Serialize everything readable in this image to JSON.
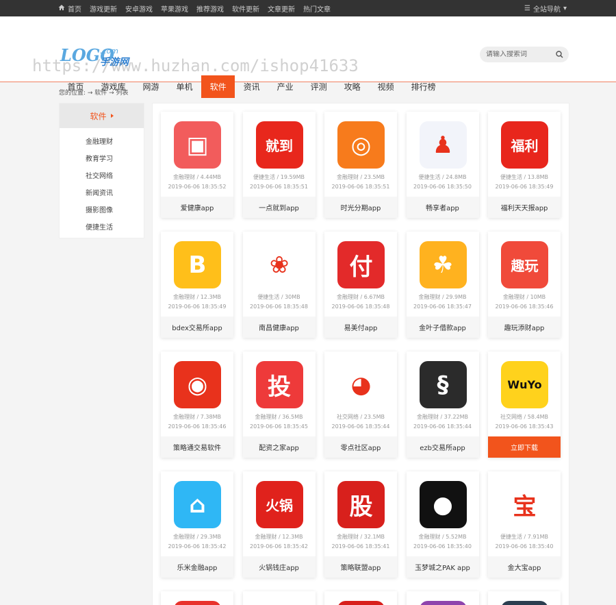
{
  "topbar": {
    "links": [
      "首页",
      "游戏更新",
      "安卓游戏",
      "苹果游戏",
      "推荐游戏",
      "软件更新",
      "文章更新",
      "热门文章"
    ],
    "site_nav": "全站导航"
  },
  "logo": {
    "main": "LOGO",
    "com": ".com",
    "sub": "手游网"
  },
  "watermark": "https://www.huzhan.com/ishop41633",
  "search": {
    "placeholder": "请输入搜索词"
  },
  "nav": {
    "items": [
      "首页",
      "游戏库",
      "网游",
      "单机",
      "软件",
      "资讯",
      "产业",
      "评测",
      "攻略",
      "视频",
      "排行榜"
    ],
    "active_index": 4
  },
  "breadcrumb": "您的位置: → 软件 → 列表",
  "sidebar": {
    "title": "软件",
    "items": [
      "金融理财",
      "教育学习",
      "社交网络",
      "新闻资讯",
      "摄影图像",
      "便捷生活"
    ]
  },
  "download_label": "立即下载",
  "apps": [
    {
      "name": "爱健康app",
      "category": "金融理财",
      "size": "4.44MB",
      "date": "2019-06-06 18:35:52",
      "icon": "health-app-icon",
      "color": "#f25c5c",
      "glyph": "▣"
    },
    {
      "name": "一点就到app",
      "category": "便捷生活",
      "size": "19.59MB",
      "date": "2019-06-06 18:35:51",
      "icon": "smile-app-icon",
      "color": "#e8271c",
      "glyph": "就到"
    },
    {
      "name": "时光分期app",
      "category": "金融理财",
      "size": "23.5MB",
      "date": "2019-06-06 18:35:51",
      "icon": "coin-app-icon",
      "color": "#f77b1c",
      "glyph": "◎"
    },
    {
      "name": "畅享者app",
      "category": "便捷生活",
      "size": "24.8MB",
      "date": "2019-06-06 18:35:50",
      "icon": "person-app-icon",
      "color": "#f2f4fa",
      "glyph": "♟"
    },
    {
      "name": "福利天天报app",
      "category": "便捷生活",
      "size": "13.8MB",
      "date": "2019-06-06 18:35:49",
      "icon": "gift-app-icon",
      "color": "#e8261c",
      "glyph": "福利"
    },
    {
      "name": "bdex交易所app",
      "category": "金融理财",
      "size": "12.3MB",
      "date": "2019-06-06 18:35:49",
      "icon": "b-app-icon",
      "color": "#ffbf1a",
      "glyph": "B"
    },
    {
      "name": "南昌健康app",
      "category": "便捷生活",
      "size": "30MB",
      "date": "2019-06-06 18:35:48",
      "icon": "emblem-app-icon",
      "color": "#ffffff",
      "glyph": "❀"
    },
    {
      "name": "易美付app",
      "category": "金融理财",
      "size": "6.67MB",
      "date": "2019-06-06 18:35:48",
      "icon": "pay-app-icon",
      "color": "#e32a2a",
      "glyph": "付"
    },
    {
      "name": "金叶子借款app",
      "category": "金融理财",
      "size": "29.9MB",
      "date": "2019-06-06 18:35:47",
      "icon": "leaf-app-icon",
      "color": "#ffb21f",
      "glyph": "☘"
    },
    {
      "name": "趣玩添财app",
      "category": "金融理财",
      "size": "10MB",
      "date": "2019-06-06 18:35:46",
      "icon": "fun-app-icon",
      "color": "#f04a3a",
      "glyph": "趣玩"
    },
    {
      "name": "策略通交易软件",
      "category": "金融理财",
      "size": "7.38MB",
      "date": "2019-06-06 18:35:46",
      "icon": "strategy-app-icon",
      "color": "#e8321c",
      "glyph": "◉"
    },
    {
      "name": "配资之家app",
      "category": "金融理财",
      "size": "36.5MB",
      "date": "2019-06-06 18:35:45",
      "icon": "invest-app-icon",
      "color": "#ee3a3a",
      "glyph": "投"
    },
    {
      "name": "零点社区app",
      "category": "社交网络",
      "size": "23.5MB",
      "date": "2019-06-06 18:35:44",
      "icon": "bubble-app-icon",
      "color": "#ffffff",
      "glyph": "◕"
    },
    {
      "name": "ezb交易所app",
      "category": "金融理财",
      "size": "37.22MB",
      "date": "2019-06-06 18:35:44",
      "icon": "ezb-app-icon",
      "color": "#2b2b2b",
      "glyph": "§"
    },
    {
      "name": "立即下载",
      "category": "社交网络",
      "size": "58.4MB",
      "date": "2019-06-06 18:35:43",
      "icon": "wuyo-app-icon",
      "color": "#ffd21c",
      "glyph": "WuYo",
      "highlight": true
    },
    {
      "name": "乐米金融app",
      "category": "金融理财",
      "size": "29.3MB",
      "date": "2019-06-06 18:35:42",
      "icon": "lemi-app-icon",
      "color": "#2fb7f5",
      "glyph": "⌂"
    },
    {
      "name": "火锅钱庄app",
      "category": "金融理财",
      "size": "12.3MB",
      "date": "2019-06-06 18:35:42",
      "icon": "hotpot-app-icon",
      "color": "#e0221c",
      "glyph": "火锅"
    },
    {
      "name": "策略联盟app",
      "category": "金融理财",
      "size": "32.1MB",
      "date": "2019-06-06 18:35:41",
      "icon": "stock-app-icon",
      "color": "#d8201c",
      "glyph": "股"
    },
    {
      "name": "玉梦城之PAK app",
      "category": "金融理财",
      "size": "5.52MB",
      "date": "2019-06-06 18:35:40",
      "icon": "disc-app-icon",
      "color": "#111111",
      "glyph": "●"
    },
    {
      "name": "金大宝app",
      "category": "便捷生活",
      "size": "7.91MB",
      "date": "2019-06-06 18:35:40",
      "icon": "treasure-app-icon",
      "color": "#ffffff",
      "glyph": "宝"
    }
  ],
  "partial_row_colors": [
    "#e8322c",
    "#ffffff",
    "#d8201c",
    "#8e44ad",
    "#2c3e50"
  ]
}
